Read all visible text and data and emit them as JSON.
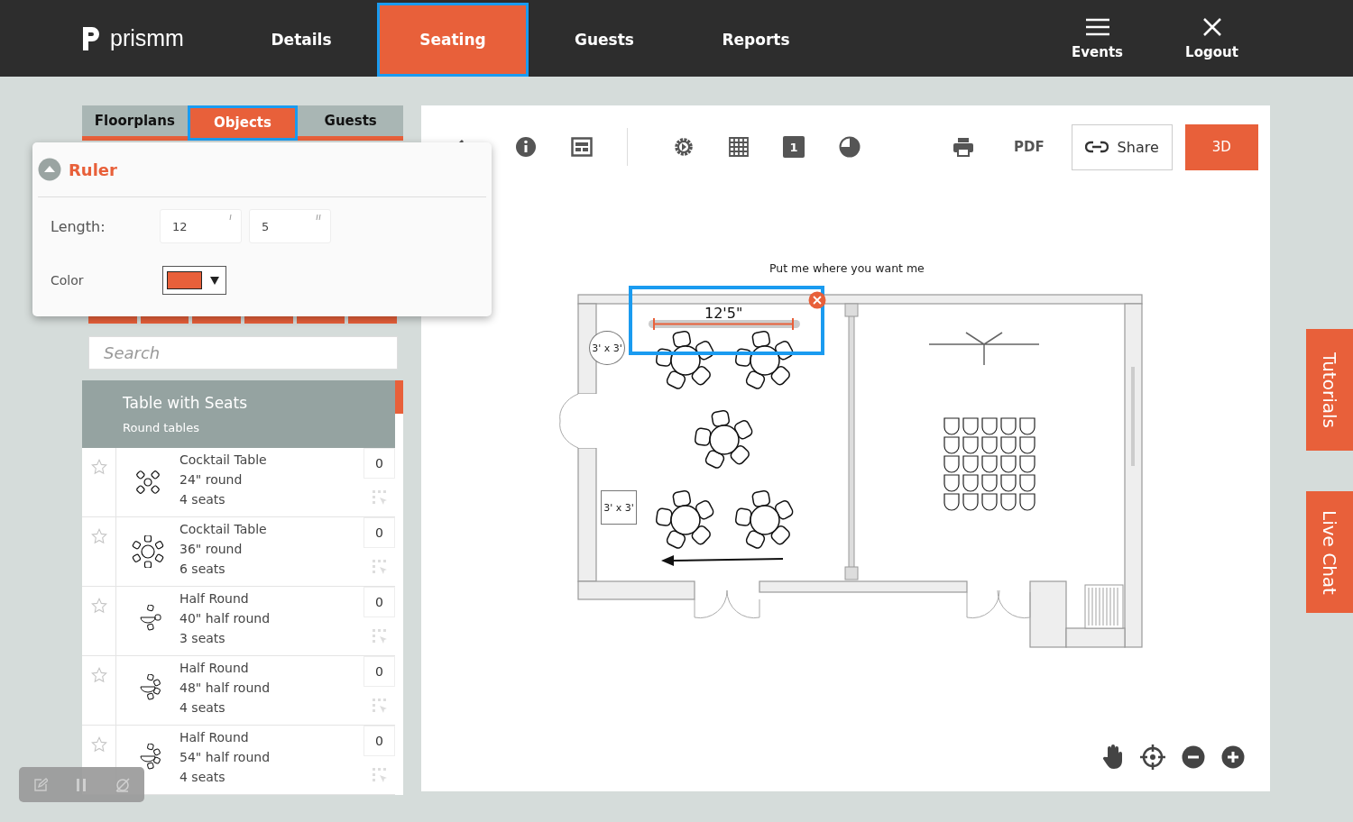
{
  "header": {
    "logo": "prismm",
    "nav": [
      {
        "label": "Details",
        "selected": false
      },
      {
        "label": "Seating",
        "selected": true
      },
      {
        "label": "Guests",
        "selected": false
      },
      {
        "label": "Reports",
        "selected": false
      }
    ],
    "actions": [
      {
        "label": "Events",
        "kind": "menu"
      },
      {
        "label": "Logout",
        "kind": "close"
      }
    ]
  },
  "panel": {
    "tabs": [
      {
        "label": "Floorplans",
        "selected": false
      },
      {
        "label": "Objects",
        "selected": true
      },
      {
        "label": "Guests",
        "selected": false
      }
    ],
    "search": {
      "placeholder": "Search"
    },
    "category": {
      "title": "Table with Seats",
      "subtitle": "Round tables"
    },
    "items": [
      {
        "name": "Cocktail Table",
        "size": "24\" round",
        "seats": "4 seats",
        "count": "0",
        "starred": false,
        "kind": "round4"
      },
      {
        "name": "Cocktail Table",
        "size": "36\" round",
        "seats": "6 seats",
        "count": "0",
        "starred": false,
        "kind": "round6"
      },
      {
        "name": "Half Round",
        "size": "40\" half round",
        "seats": "3 seats",
        "count": "0",
        "starred": false,
        "kind": "half3"
      },
      {
        "name": "Half Round",
        "size": "48\" half round",
        "seats": "4 seats",
        "count": "0",
        "starred": false,
        "kind": "half4"
      },
      {
        "name": "Half Round",
        "size": "54\" half round",
        "seats": "4 seats",
        "count": "0",
        "starred": false,
        "kind": "half4"
      }
    ]
  },
  "ruler": {
    "title": "Ruler",
    "length_label": "Length:",
    "feet": "12",
    "inches": "5",
    "color_label": "Color",
    "color": "#e8603a"
  },
  "canvas": {
    "page_number": "1",
    "pdf": "PDF",
    "share": "Share",
    "three_d": "3D",
    "hint": "Put me where you want me",
    "ruler_label": "12'5\"",
    "labels": [
      {
        "text": "3' x 3'",
        "kind": "circle"
      },
      {
        "text": "3' x 3'",
        "kind": "square"
      }
    ]
  },
  "side_tabs": [
    "Tutorials",
    "Live Chat"
  ]
}
